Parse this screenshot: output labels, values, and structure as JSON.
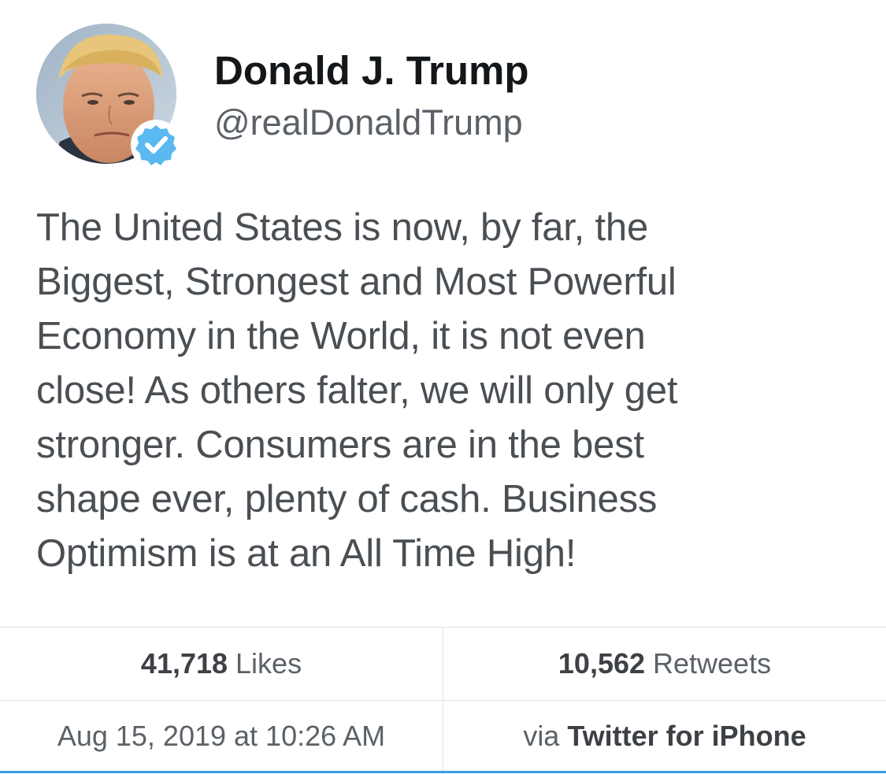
{
  "user": {
    "display_name": "Donald J. Trump",
    "handle": "@realDonaldTrump",
    "avatar_icon": "profile-photo",
    "verified_icon": "verified-badge-icon",
    "verified_color": "#1da1f2"
  },
  "tweet": {
    "lines": [
      "The United States is now, by far, the",
      "Biggest, Strongest and Most Powerful",
      "Economy in the World, it is not even",
      "close! As others falter, we will only get",
      "stronger. Consumers are in the best",
      "shape ever, plenty of cash. Business",
      "Optimism is at an All Time High!"
    ]
  },
  "stats": {
    "likes_count": "41,718",
    "likes_label": "Likes",
    "retweets_count": "10,562",
    "retweets_label": "Retweets",
    "timestamp": "Aug 15, 2019 at 10:26 AM",
    "via_label": "via",
    "source": "Twitter for iPhone"
  },
  "colors": {
    "text_primary": "#14171a",
    "text_secondary": "#5b6167",
    "divider": "#dfe3e6",
    "accent": "#3d9ee6"
  }
}
